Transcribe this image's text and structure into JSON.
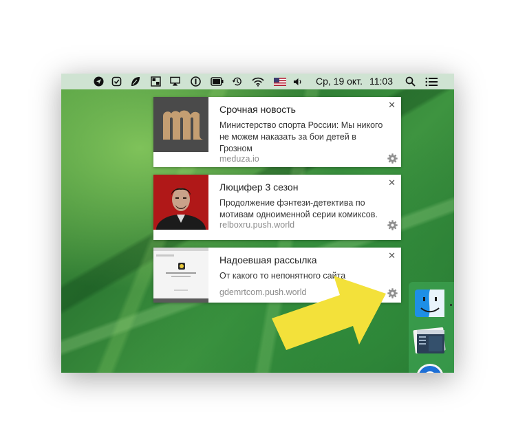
{
  "menubar": {
    "date": "Ср, 19 окт.",
    "time": "11:03"
  },
  "icons": {
    "gear": "gear-icon",
    "close": "close-icon",
    "search": "search-icon",
    "list": "notification-center-icon"
  },
  "colors": {
    "menubar": "#cfe3d2",
    "arrow": "#f3e13a",
    "meduza_bg": "#4a4a4a",
    "meduza_logo": "#c49e72"
  },
  "notifications": [
    {
      "title": "Срочная новость",
      "body": "Министерство спорта России: Мы никого не можем наказать за бои детей в Грозном",
      "source": "meduza.io",
      "close": "✕"
    },
    {
      "title": "Люцифер 3 сезон",
      "body": "Продолжение фэнтези-детектива по мотивам одноименной серии комиксов.",
      "source": "relboxru.push.world",
      "close": "✕"
    },
    {
      "title": "Надоевшая рассылка",
      "body": "От какого то непонятного сайта",
      "source": "gdemrtcom.push.world",
      "close": "✕"
    }
  ]
}
